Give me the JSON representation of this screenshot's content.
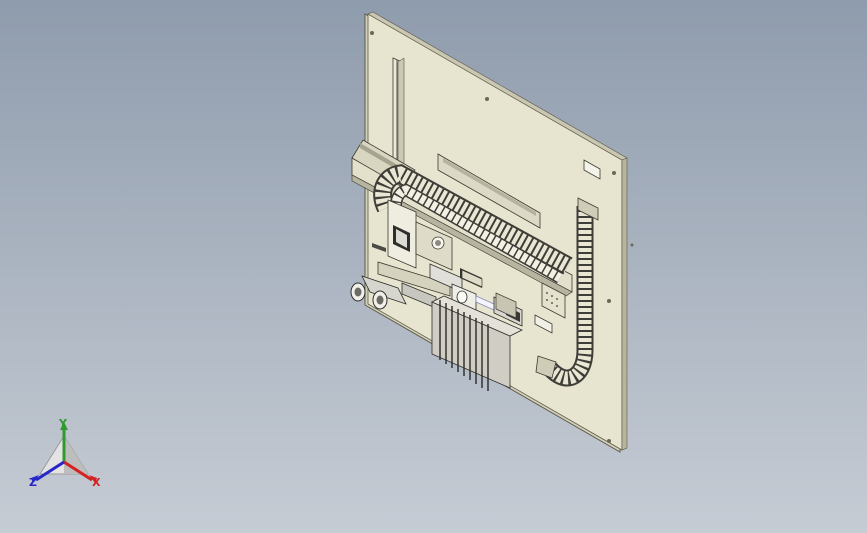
{
  "viewport": {
    "background_top": "#8f9cad",
    "background_bottom": "#c6ccd4"
  },
  "model": {
    "plate_color": "#e7e4cf",
    "plate_edge": "#5d5a4a",
    "chain_color": "#e9e6d3",
    "chain_dark": "#4a4a44",
    "heatsink_color": "#d7d5cc",
    "metal_color": "#d9d8d4",
    "dark_color": "#2e2e2c"
  },
  "triad": {
    "x_label": "X",
    "y_label": "Y",
    "z_label": "Z",
    "x_color": "#d42121",
    "y_color": "#2f9a2f",
    "z_color": "#2727c9"
  }
}
